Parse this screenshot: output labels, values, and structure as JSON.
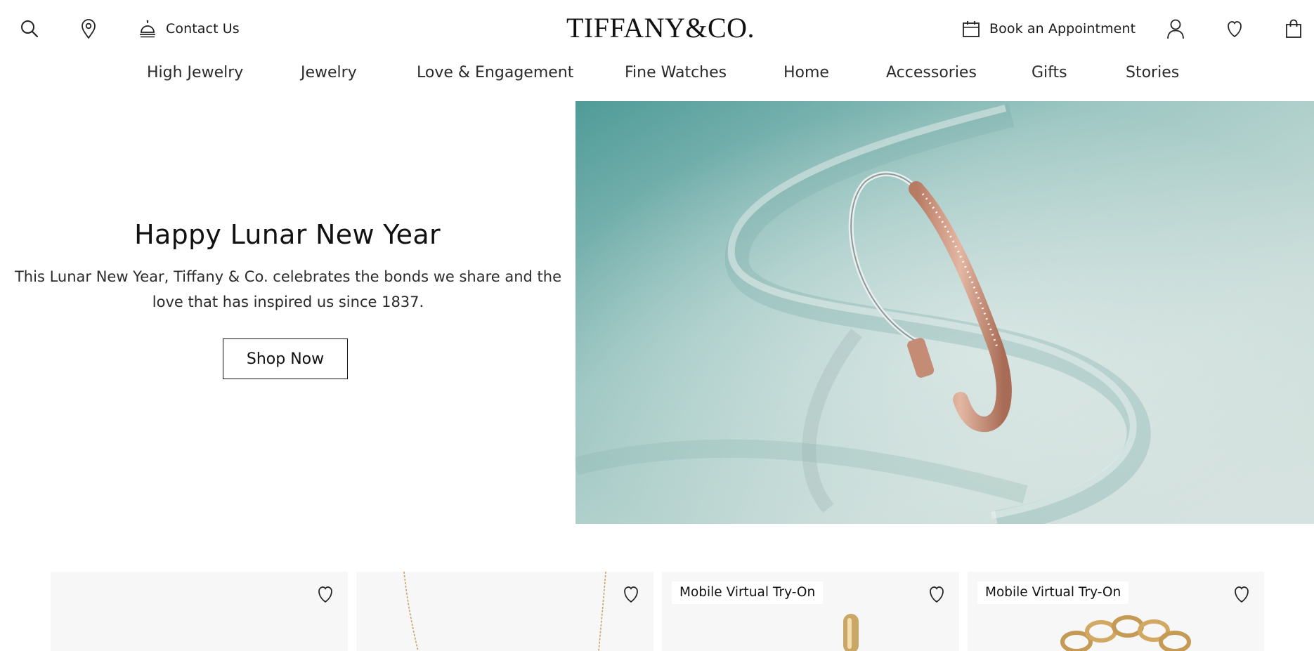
{
  "header": {
    "contact_label": "Contact Us",
    "logo_text": "TIFFANY&CO.",
    "appointment_label": "Book an Appointment"
  },
  "nav": {
    "items": [
      "High Jewelry",
      "Jewelry",
      "Love & Engagement",
      "Fine Watches",
      "Home",
      "Accessories",
      "Gifts",
      "Stories"
    ]
  },
  "hero": {
    "title": "Happy Lunar New Year",
    "subtitle_line1": "This Lunar New Year, Tiffany & Co. celebrates the bonds we share and the",
    "subtitle_line2": "love that has inspired us since 1837.",
    "button_label": "Shop Now"
  },
  "cards": [
    {
      "badge": ""
    },
    {
      "badge": ""
    },
    {
      "badge": "Mobile Virtual Try-On"
    },
    {
      "badge": "Mobile Virtual Try-On"
    }
  ],
  "icons": {
    "search": "search-icon",
    "location": "location-pin-icon",
    "contact": "concierge-bell-icon",
    "appointment": "calendar-icon",
    "account": "user-icon",
    "wishlist": "heart-icon",
    "bag": "shopping-bag-icon"
  },
  "colors": {
    "text": "#1a1a1a",
    "background": "#ffffff",
    "card_background": "#f7f7f7",
    "hero_backdrop": "#bcd6d2"
  }
}
